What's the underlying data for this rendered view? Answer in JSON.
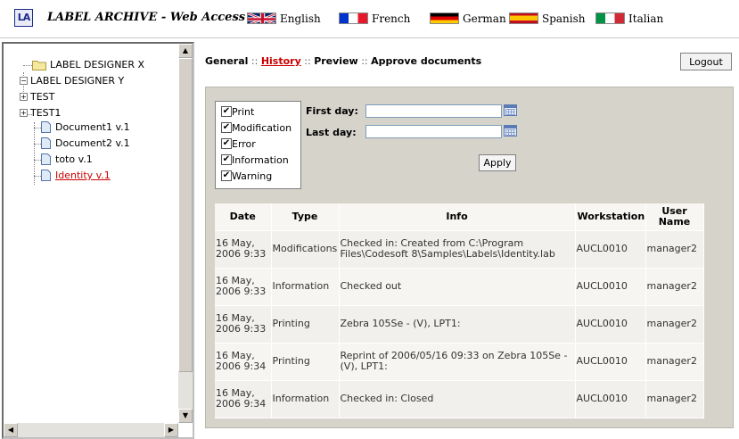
{
  "header": {
    "logo_text": "LA",
    "app_title": "LABEL ARCHIVE - Web Access",
    "languages": [
      {
        "label": "English",
        "flag": "uk-flag"
      },
      {
        "label": "French",
        "flag": "france-flag"
      },
      {
        "label": "German",
        "flag": "germany-flag"
      },
      {
        "label": "Spanish",
        "flag": "spain-flag"
      },
      {
        "label": "Italian",
        "flag": "italy-flag"
      }
    ]
  },
  "tree": {
    "items": [
      {
        "label": "LABEL DESIGNER X",
        "kind": "folder"
      },
      {
        "label": "LABEL DESIGNER Y",
        "kind": "expanded"
      },
      {
        "label": "TEST",
        "kind": "collapsed"
      },
      {
        "label": "TEST1",
        "kind": "collapsed"
      },
      {
        "label": "Document1 v.1",
        "kind": "document"
      },
      {
        "label": "Document2 v.1",
        "kind": "document"
      },
      {
        "label": "toto v.1",
        "kind": "document"
      },
      {
        "label": "Identity v.1",
        "kind": "document",
        "selected": true
      }
    ]
  },
  "nav": {
    "tabs": [
      "General",
      "History",
      "Preview",
      "Approve documents"
    ],
    "separator": "::",
    "active": "History"
  },
  "logout_label": "Logout",
  "filters": {
    "types": [
      {
        "label": "Print",
        "checked": true
      },
      {
        "label": "Modification",
        "checked": true
      },
      {
        "label": "Error",
        "checked": true
      },
      {
        "label": "Information",
        "checked": true
      },
      {
        "label": "Warning",
        "checked": true
      }
    ],
    "first_day_label": "First day:",
    "first_day_value": "",
    "last_day_label": "Last day:",
    "last_day_value": "",
    "apply_label": "Apply"
  },
  "history": {
    "columns": [
      "Date",
      "Type",
      "Info",
      "Workstation",
      "User Name"
    ],
    "rows": [
      {
        "date": "16 May, 2006 9:33",
        "type": "Modifications",
        "info": "Checked in: Created from C:\\Program Files\\Codesoft 8\\Samples\\Labels\\Identity.lab",
        "workstation": "AUCL0010",
        "user": "manager2"
      },
      {
        "date": "16 May, 2006 9:33",
        "type": "Information",
        "info": "Checked out",
        "workstation": "AUCL0010",
        "user": "manager2"
      },
      {
        "date": "16 May, 2006 9:33",
        "type": "Printing",
        "info": "Zebra 105Se - (V), LPT1:",
        "workstation": "AUCL0010",
        "user": "manager2"
      },
      {
        "date": "16 May, 2006 9:34",
        "type": "Printing",
        "info": "Reprint of 2006/05/16 09:33 on Zebra 105Se - (V), LPT1:",
        "workstation": "AUCL0010",
        "user": "manager2"
      },
      {
        "date": "16 May, 2006 9:34",
        "type": "Information",
        "info": "Checked in: Closed",
        "workstation": "AUCL0010",
        "user": "manager2"
      }
    ]
  },
  "colors": {
    "accent_red": "#cc0000",
    "panel_gray": "#d6d3cb",
    "logo_blue": "#1a2a8a"
  }
}
